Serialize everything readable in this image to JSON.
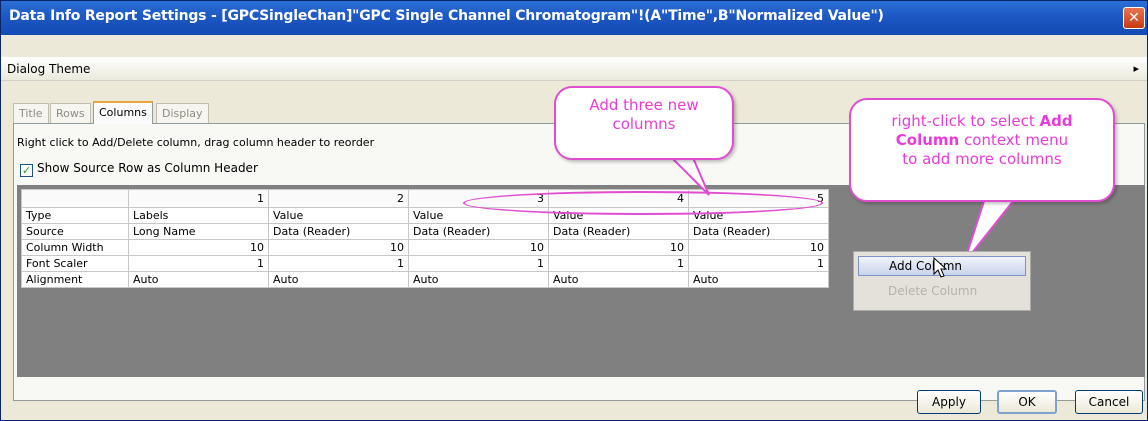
{
  "window": {
    "title": "Data Info Report Settings - [GPCSingleChan]\"GPC Single Channel Chromatogram\"!(A\"Time\",B\"Normalized Value\")",
    "close_glyph": "✕"
  },
  "theme": {
    "label": "Dialog Theme",
    "arrow_glyph": "▸"
  },
  "tabs": [
    {
      "label": "Title"
    },
    {
      "label": "Rows"
    },
    {
      "label": "Columns"
    },
    {
      "label": "Display"
    }
  ],
  "active_tab": "Columns",
  "columns_tab": {
    "hint": "Right click to Add/Delete column, drag column header to reorder",
    "checkbox_label": "Show Source Row as Column Header",
    "checkbox_checked": true,
    "column_numbers": [
      "1",
      "2",
      "3",
      "4",
      "5"
    ],
    "rows": [
      {
        "label": "Type",
        "cells": [
          "Labels",
          "Value",
          "Value",
          "Value",
          "Value"
        ]
      },
      {
        "label": "Source",
        "cells": [
          "Long Name",
          "Data (Reader)",
          "Data (Reader)",
          "Data (Reader)",
          "Data (Reader)"
        ]
      },
      {
        "label": "Column Width",
        "cells": [
          "10",
          "10",
          "10",
          "10",
          "10"
        ]
      },
      {
        "label": "Font Scaler",
        "cells": [
          "1",
          "1",
          "1",
          "1",
          "1"
        ]
      },
      {
        "label": "Alignment",
        "cells": [
          "Auto",
          "Auto",
          "Auto",
          "Auto",
          "Auto"
        ]
      }
    ]
  },
  "callouts": {
    "add_three": {
      "line1": "Add three new",
      "line2": "columns"
    },
    "right_click": {
      "part1": "right-click to select ",
      "bold1": "Add",
      "bold2": "Column",
      "part2": " context menu",
      "line3": "to add more columns"
    }
  },
  "context_menu": {
    "add_column": "Add Column",
    "delete_column": "Delete Column"
  },
  "buttons": {
    "apply": "Apply",
    "ok": "OK",
    "cancel": "Cancel"
  },
  "colors": {
    "annotation": "#e04ed0",
    "titlebar": "#1d58c4"
  }
}
